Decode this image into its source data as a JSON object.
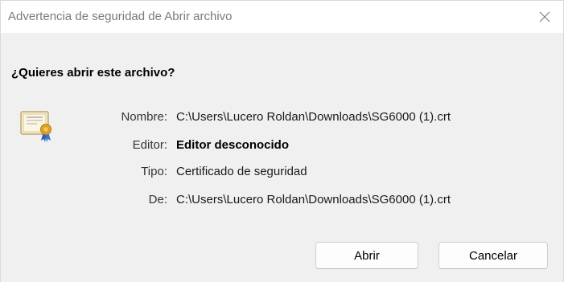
{
  "window": {
    "title": "Advertencia de seguridad de Abrir archivo",
    "close_icon": "close-icon"
  },
  "question": "¿Quieres abrir este archivo?",
  "file_icon": "certificate-icon",
  "details": {
    "name_label": "Nombre:",
    "name_value": "C:\\Users\\Lucero Roldan\\Downloads\\SG6000 (1).crt",
    "publisher_label": "Editor:",
    "publisher_value": "Editor desconocido",
    "type_label": "Tipo:",
    "type_value": "Certificado de seguridad",
    "from_label": "De:",
    "from_value": "C:\\Users\\Lucero Roldan\\Downloads\\SG6000 (1).crt"
  },
  "buttons": {
    "open_label": "Abrir",
    "cancel_label": "Cancelar"
  },
  "colors": {
    "title_text": "#7a7a7a",
    "dialog_background": "#f0f0f0",
    "titlebar_background": "#ffffff"
  }
}
